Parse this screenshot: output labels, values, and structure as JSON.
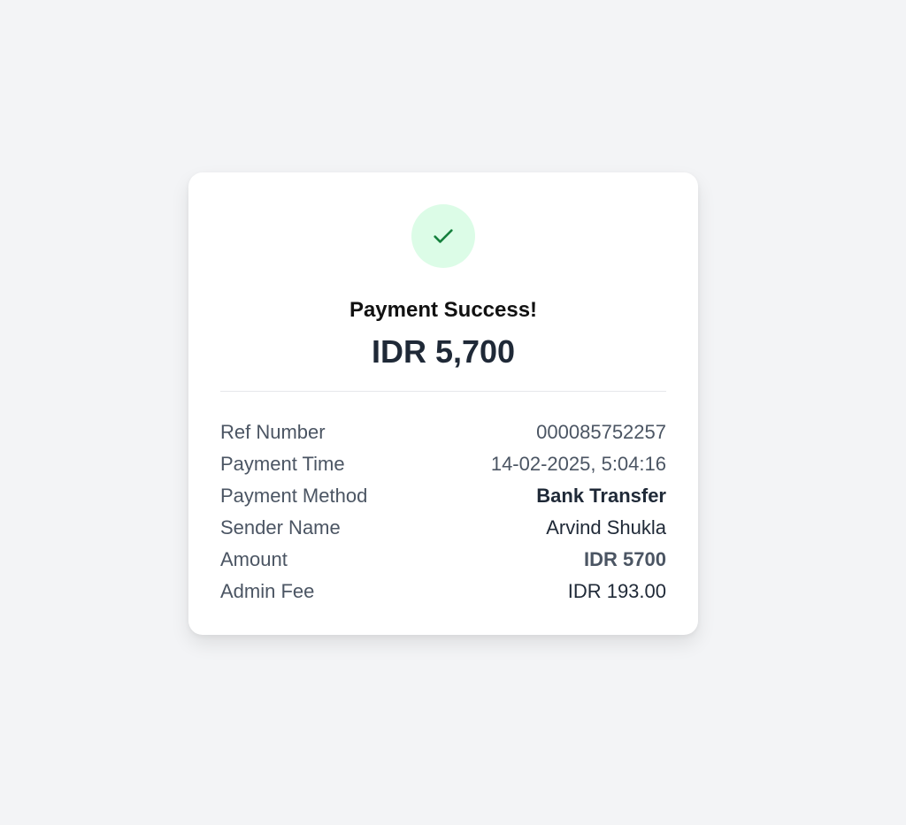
{
  "receipt": {
    "status_icon": "checkmark-icon",
    "title": "Payment Success!",
    "amount": "IDR 5,700",
    "details": {
      "ref_number": {
        "label": "Ref Number",
        "value": "000085752257"
      },
      "payment_time": {
        "label": "Payment Time",
        "value": "14-02-2025, 5:04:16"
      },
      "payment_method": {
        "label": "Payment Method",
        "value": "Bank Transfer"
      },
      "sender_name": {
        "label": "Sender Name",
        "value": "Arvind Shukla"
      },
      "amount": {
        "label": "Amount",
        "value": "IDR 5700"
      },
      "admin_fee": {
        "label": "Admin Fee",
        "value": "IDR 193.00"
      }
    }
  },
  "colors": {
    "background": "#f3f4f6",
    "card": "#ffffff",
    "success_bg": "#dcfce7",
    "success_icon": "#15803d",
    "text_dark": "#1f2937",
    "text_muted": "#4b5563"
  }
}
